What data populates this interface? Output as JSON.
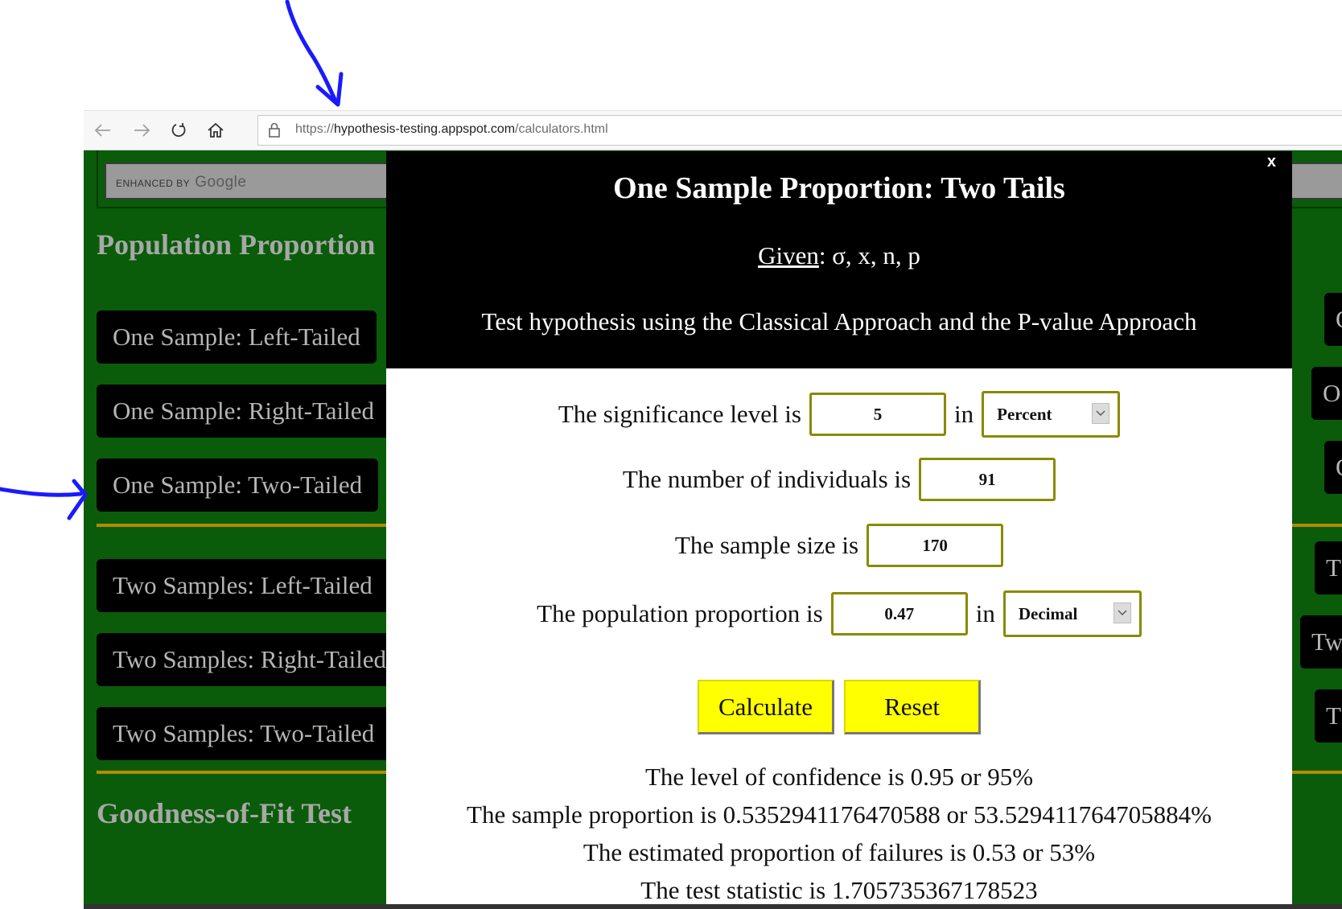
{
  "browser": {
    "url_prefix": "https://",
    "url_host": "hypothesis-testing.appspot.com",
    "url_path": "/calculators.html",
    "back_icon": "arrow-left",
    "forward_icon": "arrow-right",
    "refresh_icon": "refresh",
    "home_icon": "home",
    "lock_icon": "lock"
  },
  "page": {
    "search_enhanced": "ENHANCED BY",
    "search_brand": "Google",
    "section_population": "Population Proportion",
    "section_goodness": "Goodness-of-Fit Test",
    "sidebar_buttons": [
      "One Sample: Left-Tailed",
      "One Sample: Right-Tailed",
      "One Sample: Two-Tailed",
      "Two Samples: Left-Tailed",
      "Two Samples: Right-Tailed",
      "Two Samples: Two-Tailed"
    ],
    "right_buttons": [
      "O",
      "O",
      "O",
      "T",
      "Tw",
      "T"
    ],
    "accent": "#0a5c0a",
    "divider_color": "#b58a00"
  },
  "modal": {
    "close_label": "x",
    "title": "One Sample Proportion: Two Tails",
    "given_label": "Given",
    "given_values": ": σ, x, n, p",
    "description": "Test hypothesis using the Classical Approach and the P-value Approach",
    "significance_label": "The significance level is",
    "significance_value": "5",
    "in_label": "in",
    "significance_unit": "Percent",
    "individuals_label": "The number of individuals is",
    "individuals_value": "91",
    "sample_size_label": "The sample size is",
    "sample_size_value": "170",
    "population_label": "The population proportion is",
    "population_value": "0.47",
    "population_unit": "Decimal",
    "calculate_label": "Calculate",
    "reset_label": "Reset",
    "results": [
      "The level of confidence is 0.95 or 95%",
      "The sample proportion is 0.5352941176470588 or 53.529411764705884%",
      "The estimated proportion of failures is 0.53 or 53%",
      "The test statistic is 1.705735367178523"
    ],
    "button_color": "#ffff00",
    "field_border_color": "#8a8a00"
  }
}
